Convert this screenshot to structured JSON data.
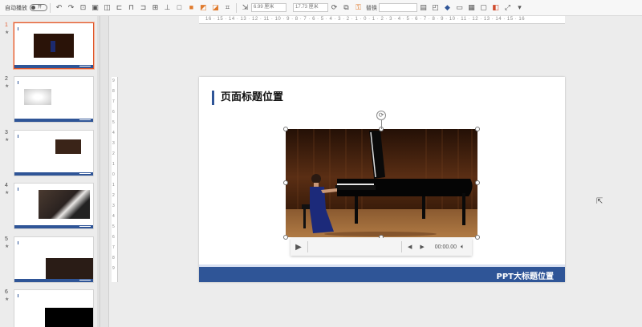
{
  "toolbar": {
    "autoplay_label": "自动播放",
    "autoplay_toggle": "开",
    "width_value": "6.99 厘米",
    "height_value": "17.73 厘米",
    "replace_label": "替换",
    "icons": [
      "undo-icon",
      "redo-icon",
      "format-painter-icon",
      "crop-icon",
      "shape-icon",
      "group-icon",
      "align-icon",
      "rotate-icon",
      "arrange-icon",
      "lock-icon",
      "resize-icon"
    ]
  },
  "thumbnails": [
    {
      "number": "1",
      "marker": "★",
      "selected": true
    },
    {
      "number": "2",
      "marker": "★",
      "selected": false
    },
    {
      "number": "3",
      "marker": "★",
      "selected": false
    },
    {
      "number": "4",
      "marker": "★",
      "selected": false
    },
    {
      "number": "5",
      "marker": "★",
      "selected": false
    },
    {
      "number": "6",
      "marker": "★",
      "selected": false
    }
  ],
  "ruler": {
    "horizontal": "16 · 15 · 14 · 13 · 12 · 11 · 10 · 9 · 8 · 7 · 6 · 5 · 4 · 3 · 2 · 1 · 0 · 1 · 2 · 3 · 4 · 5 · 6 · 7 · 8 · 9 · 10 · 11 · 12 · 13 · 14 · 15 · 16",
    "vertical": [
      "9",
      "8",
      "7",
      "6",
      "5",
      "4",
      "3",
      "2",
      "1",
      "0",
      "1",
      "2",
      "3",
      "4",
      "5",
      "6",
      "7",
      "8",
      "9"
    ]
  },
  "slide": {
    "title": "页面标题位置",
    "footer_text": "PPT大标题位置",
    "accent_color": "#2f5597"
  },
  "video_controls": {
    "time": "00:00.00",
    "play_icon": "play-icon",
    "prev_icon": "step-back-icon",
    "next_icon": "step-forward-icon",
    "volume_icon": "volume-icon"
  }
}
